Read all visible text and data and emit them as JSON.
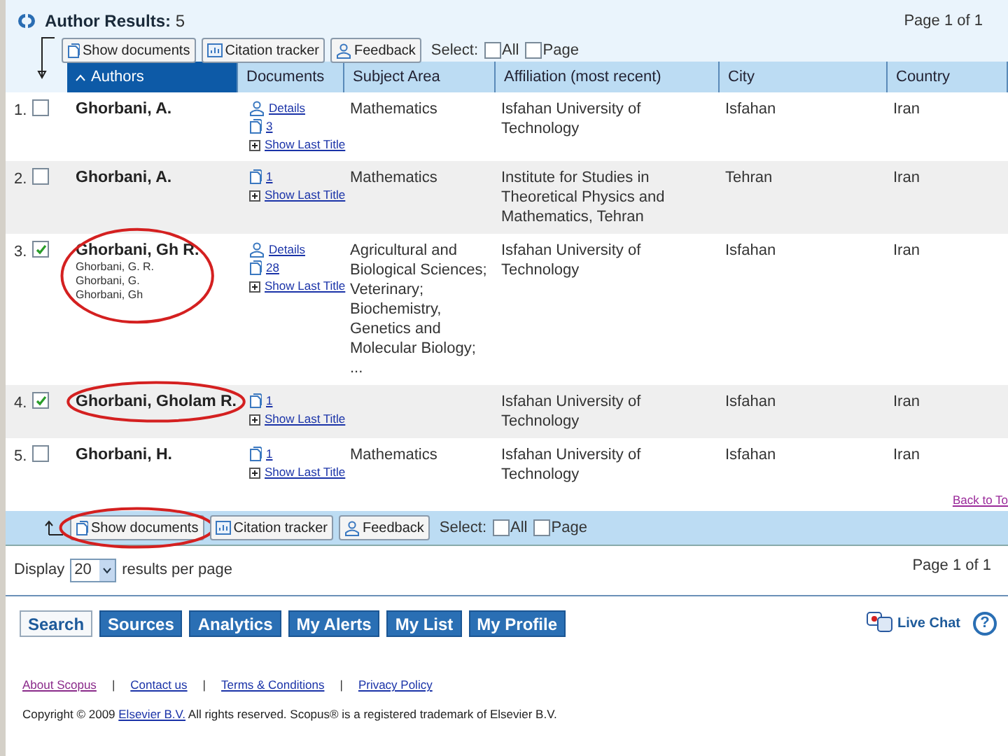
{
  "header": {
    "title": "Author Results:",
    "count": "5",
    "page": "Page  1 of 1"
  },
  "top_toolbar": {
    "buttons": [
      {
        "label": "Show documents",
        "circled": false
      },
      {
        "label": "Citation tracker",
        "circled": false
      },
      {
        "label": "Feedback",
        "circled": false
      }
    ],
    "select_label": "Select:",
    "options": [
      {
        "label": "All",
        "checked": false
      },
      {
        "label": "Page",
        "checked": false
      }
    ]
  },
  "table": {
    "columns": [
      {
        "label": "Authors",
        "sorted": true
      },
      {
        "label": "Documents",
        "sorted": false
      },
      {
        "label": "Subject Area",
        "sorted": false
      },
      {
        "label": "Affiliation (most recent)",
        "sorted": false
      },
      {
        "label": "City",
        "sorted": false
      },
      {
        "label": "Country",
        "sorted": false
      }
    ],
    "rows": [
      {
        "index": "1.",
        "checked": false,
        "circled": false,
        "name": "Ghorbani, A.",
        "documents": [
          {
            "kind": "details",
            "label": "Details"
          },
          {
            "kind": "docs",
            "label": "3"
          },
          {
            "kind": "last",
            "label": "Show Last Title"
          }
        ],
        "subject": "Mathematics",
        "affiliation": "Isfahan University of Technology",
        "city": "Isfahan",
        "country": "Iran"
      },
      {
        "index": "2.",
        "checked": false,
        "circled": false,
        "name": "Ghorbani, A.",
        "documents": [
          {
            "kind": "docs",
            "label": "1"
          },
          {
            "kind": "last",
            "label": "Show Last Title"
          }
        ],
        "subject": "Mathematics",
        "affiliation": "Institute for Studies in Theoretical Physics and Mathematics, Tehran",
        "city": "Tehran",
        "country": "Iran"
      },
      {
        "index": "3.",
        "checked": true,
        "circled": true,
        "name": "Ghorbani, Gh R.",
        "variants": [
          "Ghorbani, G. R.",
          "Ghorbani, G.",
          "Ghorbani, Gh"
        ],
        "documents": [
          {
            "kind": "details",
            "label": "Details"
          },
          {
            "kind": "docs",
            "label": "28"
          },
          {
            "kind": "last",
            "label": "Show Last Title"
          }
        ],
        "subject": "Agricultural and Biological Sciences; Veterinary; Biochemistry, Genetics and Molecular Biology; ...",
        "affiliation": "Isfahan University of Technology",
        "city": "Isfahan",
        "country": "Iran"
      },
      {
        "index": "4.",
        "checked": true,
        "circled": true,
        "name": "Ghorbani, Gholam R.",
        "documents": [
          {
            "kind": "docs",
            "label": "1"
          },
          {
            "kind": "last",
            "label": "Show Last Title"
          }
        ],
        "affiliation": "Isfahan University of Technology",
        "city": "Isfahan",
        "country": "Iran"
      },
      {
        "index": "5.",
        "checked": false,
        "circled": false,
        "name": "Ghorbani, H.",
        "documents": [
          {
            "kind": "docs",
            "label": "1"
          },
          {
            "kind": "last",
            "label": "Show Last Title"
          }
        ],
        "subject": "Mathematics",
        "affiliation": "Isfahan University of Technology",
        "city": "Isfahan",
        "country": "Iran"
      }
    ]
  },
  "back_to_top": "Back to To",
  "bottom_toolbar": {
    "buttons": [
      {
        "label": "Show documents",
        "circled": true
      },
      {
        "label": "Citation tracker",
        "circled": false
      },
      {
        "label": "Feedback",
        "circled": false
      }
    ],
    "select_label": "Select:",
    "options": [
      {
        "label": "All",
        "checked": false
      },
      {
        "label": "Page",
        "checked": false
      }
    ]
  },
  "display": {
    "label": "Display",
    "value": "20",
    "suffix": "results per page",
    "page": "Page 1 of 1"
  },
  "nav": [
    {
      "label": "Search",
      "selected": true
    },
    {
      "label": "Sources",
      "selected": false
    },
    {
      "label": "Analytics",
      "selected": false
    },
    {
      "label": "My Alerts",
      "selected": false
    },
    {
      "label": "My List",
      "selected": false
    },
    {
      "label": "My Profile",
      "selected": false
    }
  ],
  "live_chat": "Live Chat",
  "help": "?",
  "footer": [
    {
      "kind": "link",
      "label": "About Scopus",
      "visited": true
    },
    {
      "kind": "separator",
      "label": "|"
    },
    {
      "kind": "link",
      "label": "Contact us",
      "visited": false
    },
    {
      "kind": "separator",
      "label": "|"
    },
    {
      "kind": "link",
      "label": "Terms & Conditions",
      "visited": false
    },
    {
      "kind": "separator",
      "label": "|"
    },
    {
      "kind": "link",
      "label": "Privacy Policy",
      "visited": false
    }
  ],
  "copyright": {
    "before": "Copyright © 2009",
    "link": "Elsevier B.V.",
    "after": "All rights reserved. Scopus® is a registered trademark of Elsevier B.V."
  }
}
